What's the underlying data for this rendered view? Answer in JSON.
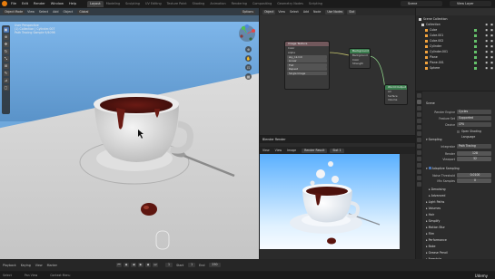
{
  "menubar": {
    "items": [
      "File",
      "Edit",
      "Render",
      "Window",
      "Help"
    ],
    "workspace_tabs": [
      "Layout",
      "Modeling",
      "Sculpting",
      "UV Editing",
      "Texture Paint",
      "Shading",
      "Animation",
      "Rendering",
      "Compositing",
      "Geometry Nodes",
      "Scripting"
    ],
    "active_tab": "Layout",
    "scene": "Scene",
    "view_layer": "View Layer"
  },
  "viewport": {
    "mode": "Object Mode",
    "header_items": [
      "View",
      "Select",
      "Add",
      "Object"
    ],
    "transform": "Global",
    "options": "Options",
    "info_lines": [
      "User Perspective",
      "(1) Collection | Cylinder.007",
      "Path Tracing Sample 9/4096"
    ],
    "tools": [
      "cursor",
      "move",
      "rotate",
      "scale",
      "transform",
      "annotate",
      "measure",
      "add"
    ]
  },
  "node_editor": {
    "header_items": [
      "Object",
      "View",
      "Select",
      "Add",
      "Node"
    ],
    "use_nodes": "Use Nodes",
    "slot": "Slot",
    "material": "Material",
    "nodes": {
      "tex": {
        "title": "Image Texture",
        "rows": [
          "Color",
          "Alpha"
        ],
        "fields": [
          "sky_1k.hdr",
          "Linear",
          "Flat",
          "Repeat",
          "Single Image",
          "Color Space",
          "Alpha"
        ]
      },
      "bg": {
        "title": "Background",
        "rows": [
          "Background",
          "Color",
          "Strength"
        ]
      },
      "out": {
        "title": "World Output",
        "rows": [
          "All",
          "Surface",
          "Volume"
        ]
      }
    }
  },
  "render_window": {
    "title": "Blender Render",
    "header_items": [
      "View",
      "View",
      "Image"
    ],
    "image_name": "Render Result",
    "slot": "Slot 1",
    "layer": "View Layer",
    "pass": "Combined"
  },
  "outliner": {
    "items": [
      {
        "label": "Scene Collection",
        "icon": "collection-icon",
        "indent": 0
      },
      {
        "label": "Collection",
        "icon": "collection-icon",
        "indent": 1
      },
      {
        "label": "Cube",
        "icon": "mesh-icon",
        "indent": 2
      },
      {
        "label": "Cube.001",
        "icon": "mesh-icon",
        "indent": 2
      },
      {
        "label": "Cube.002",
        "icon": "mesh-icon",
        "indent": 2
      },
      {
        "label": "Cylinder",
        "icon": "mesh-icon",
        "indent": 2
      },
      {
        "label": "Cylinder.001",
        "icon": "mesh-icon",
        "indent": 2
      },
      {
        "label": "Plane",
        "icon": "mesh-icon",
        "indent": 2
      },
      {
        "label": "Plane.001",
        "icon": "mesh-icon",
        "indent": 2
      },
      {
        "label": "Sphere",
        "icon": "mesh-icon",
        "indent": 2
      }
    ]
  },
  "properties": {
    "scene_label": "Scene",
    "render_engine_label": "Render Engine",
    "render_engine": "Cycles",
    "feature_set_label": "Feature Set",
    "feature_set": "Supported",
    "device_label": "Device",
    "device": "CPU",
    "osl_label": "Open Shading Language",
    "sampling_label": "Sampling",
    "integrator_label": "Integrator",
    "integrator": "Path Tracing",
    "render_label": "Render",
    "render_samples": "128",
    "viewport_label": "Viewport",
    "viewport_samples": "32",
    "adaptive_label": "Adaptive Sampling",
    "noise_label": "Noise Threshold",
    "noise_threshold": "0.0100",
    "min_samples_label": "Min Samples",
    "min_samples": "0",
    "denoising_label": "Denoising",
    "advanced_label": "Advanced",
    "sections": [
      "Light Paths",
      "Volumes",
      "Hair",
      "Simplify",
      "Motion Blur",
      "Film",
      "Performance",
      "Bake",
      "Grease Pencil",
      "Freestyle",
      "Color Management"
    ]
  },
  "playback": {
    "items": [
      "Playback",
      "Keying",
      "View",
      "Marker"
    ],
    "frame_current": "1",
    "start_label": "Start",
    "start": "1",
    "end_label": "End",
    "end": "250"
  },
  "status": {
    "items": [
      "Select",
      "Pan View",
      "Context Menu"
    ],
    "brand": "Udemy"
  },
  "colors": {
    "accent": "#4772b3",
    "blender_orange": "#e87d0d",
    "node_input": "#72585c",
    "node_shader": "#3b7d4e",
    "node_output": "#632e2e"
  }
}
